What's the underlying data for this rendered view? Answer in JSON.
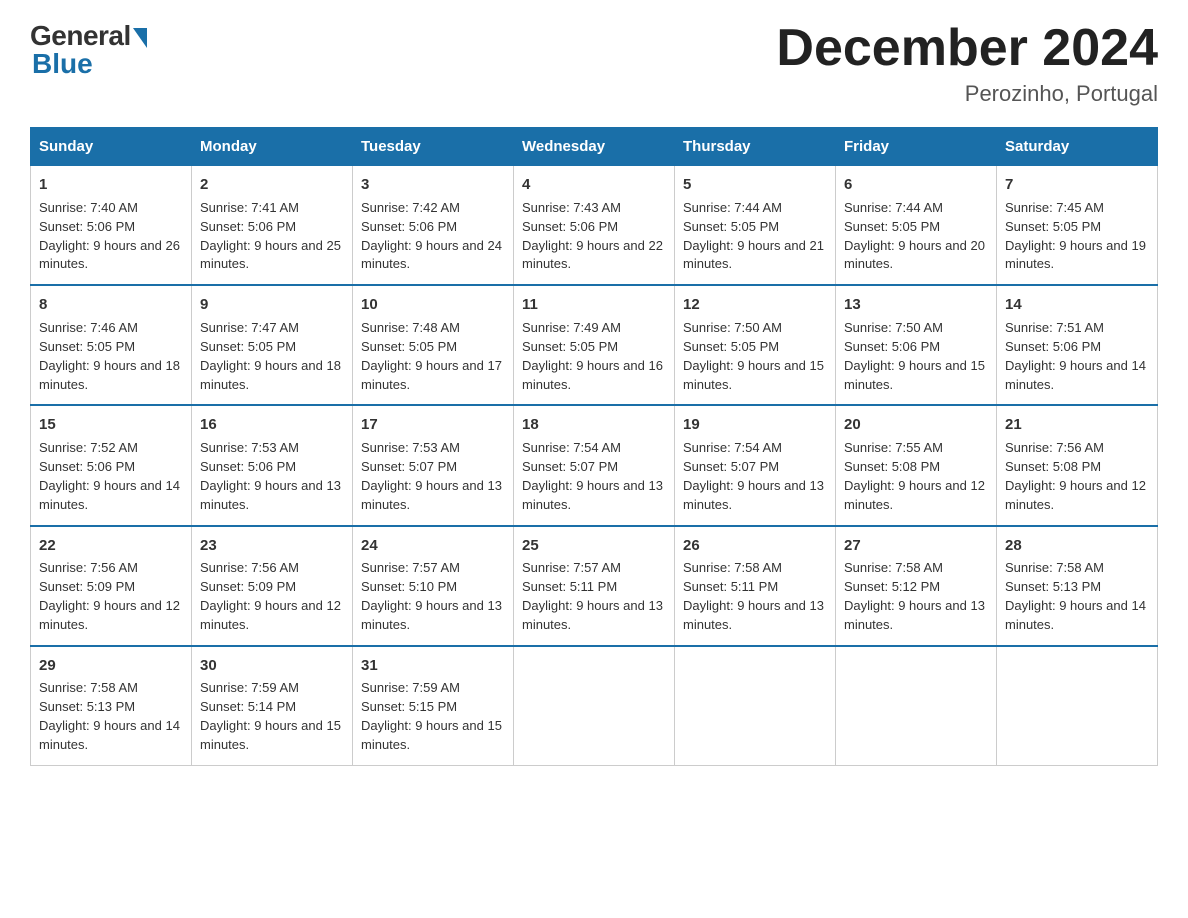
{
  "header": {
    "logo_general": "General",
    "logo_blue": "Blue",
    "title": "December 2024",
    "location": "Perozinho, Portugal"
  },
  "days_of_week": [
    "Sunday",
    "Monday",
    "Tuesday",
    "Wednesday",
    "Thursday",
    "Friday",
    "Saturday"
  ],
  "weeks": [
    [
      {
        "day": "1",
        "sunrise": "7:40 AM",
        "sunset": "5:06 PM",
        "daylight": "9 hours and 26 minutes."
      },
      {
        "day": "2",
        "sunrise": "7:41 AM",
        "sunset": "5:06 PM",
        "daylight": "9 hours and 25 minutes."
      },
      {
        "day": "3",
        "sunrise": "7:42 AM",
        "sunset": "5:06 PM",
        "daylight": "9 hours and 24 minutes."
      },
      {
        "day": "4",
        "sunrise": "7:43 AM",
        "sunset": "5:06 PM",
        "daylight": "9 hours and 22 minutes."
      },
      {
        "day": "5",
        "sunrise": "7:44 AM",
        "sunset": "5:05 PM",
        "daylight": "9 hours and 21 minutes."
      },
      {
        "day": "6",
        "sunrise": "7:44 AM",
        "sunset": "5:05 PM",
        "daylight": "9 hours and 20 minutes."
      },
      {
        "day": "7",
        "sunrise": "7:45 AM",
        "sunset": "5:05 PM",
        "daylight": "9 hours and 19 minutes."
      }
    ],
    [
      {
        "day": "8",
        "sunrise": "7:46 AM",
        "sunset": "5:05 PM",
        "daylight": "9 hours and 18 minutes."
      },
      {
        "day": "9",
        "sunrise": "7:47 AM",
        "sunset": "5:05 PM",
        "daylight": "9 hours and 18 minutes."
      },
      {
        "day": "10",
        "sunrise": "7:48 AM",
        "sunset": "5:05 PM",
        "daylight": "9 hours and 17 minutes."
      },
      {
        "day": "11",
        "sunrise": "7:49 AM",
        "sunset": "5:05 PM",
        "daylight": "9 hours and 16 minutes."
      },
      {
        "day": "12",
        "sunrise": "7:50 AM",
        "sunset": "5:05 PM",
        "daylight": "9 hours and 15 minutes."
      },
      {
        "day": "13",
        "sunrise": "7:50 AM",
        "sunset": "5:06 PM",
        "daylight": "9 hours and 15 minutes."
      },
      {
        "day": "14",
        "sunrise": "7:51 AM",
        "sunset": "5:06 PM",
        "daylight": "9 hours and 14 minutes."
      }
    ],
    [
      {
        "day": "15",
        "sunrise": "7:52 AM",
        "sunset": "5:06 PM",
        "daylight": "9 hours and 14 minutes."
      },
      {
        "day": "16",
        "sunrise": "7:53 AM",
        "sunset": "5:06 PM",
        "daylight": "9 hours and 13 minutes."
      },
      {
        "day": "17",
        "sunrise": "7:53 AM",
        "sunset": "5:07 PM",
        "daylight": "9 hours and 13 minutes."
      },
      {
        "day": "18",
        "sunrise": "7:54 AM",
        "sunset": "5:07 PM",
        "daylight": "9 hours and 13 minutes."
      },
      {
        "day": "19",
        "sunrise": "7:54 AM",
        "sunset": "5:07 PM",
        "daylight": "9 hours and 13 minutes."
      },
      {
        "day": "20",
        "sunrise": "7:55 AM",
        "sunset": "5:08 PM",
        "daylight": "9 hours and 12 minutes."
      },
      {
        "day": "21",
        "sunrise": "7:56 AM",
        "sunset": "5:08 PM",
        "daylight": "9 hours and 12 minutes."
      }
    ],
    [
      {
        "day": "22",
        "sunrise": "7:56 AM",
        "sunset": "5:09 PM",
        "daylight": "9 hours and 12 minutes."
      },
      {
        "day": "23",
        "sunrise": "7:56 AM",
        "sunset": "5:09 PM",
        "daylight": "9 hours and 12 minutes."
      },
      {
        "day": "24",
        "sunrise": "7:57 AM",
        "sunset": "5:10 PM",
        "daylight": "9 hours and 13 minutes."
      },
      {
        "day": "25",
        "sunrise": "7:57 AM",
        "sunset": "5:11 PM",
        "daylight": "9 hours and 13 minutes."
      },
      {
        "day": "26",
        "sunrise": "7:58 AM",
        "sunset": "5:11 PM",
        "daylight": "9 hours and 13 minutes."
      },
      {
        "day": "27",
        "sunrise": "7:58 AM",
        "sunset": "5:12 PM",
        "daylight": "9 hours and 13 minutes."
      },
      {
        "day": "28",
        "sunrise": "7:58 AM",
        "sunset": "5:13 PM",
        "daylight": "9 hours and 14 minutes."
      }
    ],
    [
      {
        "day": "29",
        "sunrise": "7:58 AM",
        "sunset": "5:13 PM",
        "daylight": "9 hours and 14 minutes."
      },
      {
        "day": "30",
        "sunrise": "7:59 AM",
        "sunset": "5:14 PM",
        "daylight": "9 hours and 15 minutes."
      },
      {
        "day": "31",
        "sunrise": "7:59 AM",
        "sunset": "5:15 PM",
        "daylight": "9 hours and 15 minutes."
      },
      null,
      null,
      null,
      null
    ]
  ]
}
